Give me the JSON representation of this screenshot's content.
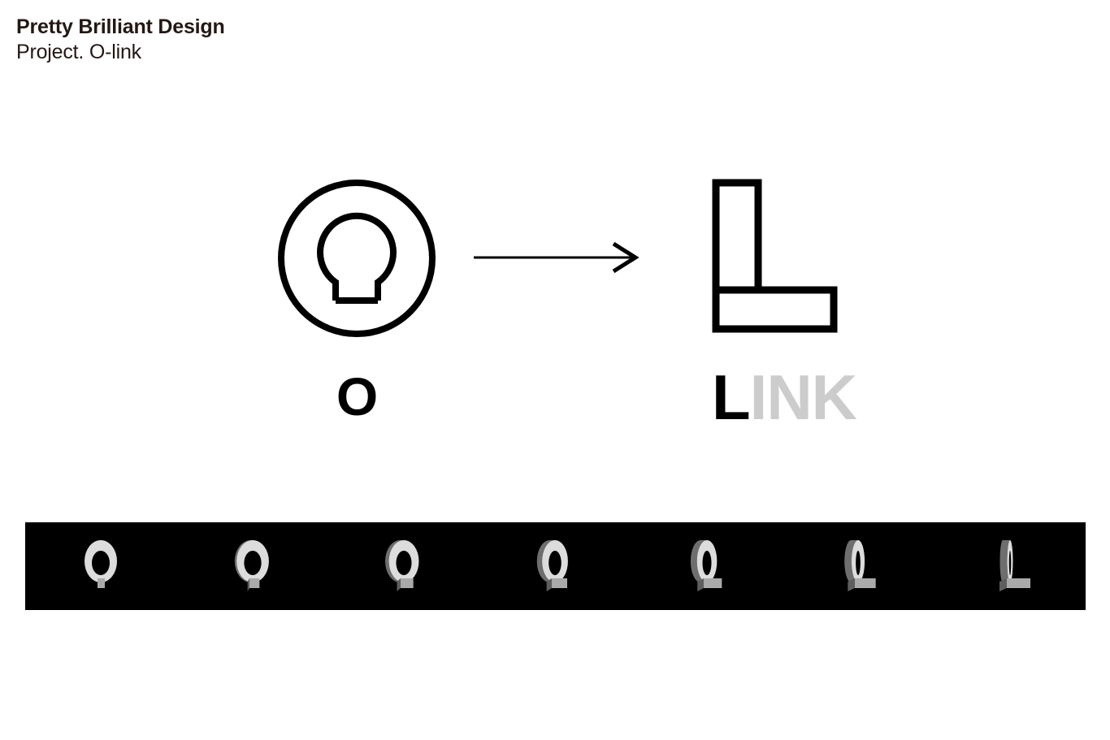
{
  "header": {
    "title": "Pretty Brilliant Design",
    "subtitle": "Project. O-link"
  },
  "concept": {
    "source_mark_name": "o-ring-mark",
    "target_mark_name": "l-block-mark",
    "arrow_name": "transform-arrow",
    "label_o": "O",
    "label_link_black": "L",
    "label_link_grey": "INK"
  },
  "colors": {
    "text_dark": "#231815",
    "black": "#000000",
    "grey_light": "#cccccc",
    "strip_background": "#000000",
    "page_background": "#ffffff"
  },
  "filmstrip": {
    "background": "#000000",
    "frame_count": 7,
    "frames": [
      {
        "index": 1,
        "label": "frame-1-o",
        "rotation_deg": 0
      },
      {
        "index": 2,
        "label": "frame-2",
        "rotation_deg": 15
      },
      {
        "index": 3,
        "label": "frame-3",
        "rotation_deg": 30
      },
      {
        "index": 4,
        "label": "frame-4",
        "rotation_deg": 45
      },
      {
        "index": 5,
        "label": "frame-5",
        "rotation_deg": 60
      },
      {
        "index": 6,
        "label": "frame-6",
        "rotation_deg": 75
      },
      {
        "index": 7,
        "label": "frame-7-l",
        "rotation_deg": 90
      }
    ]
  }
}
